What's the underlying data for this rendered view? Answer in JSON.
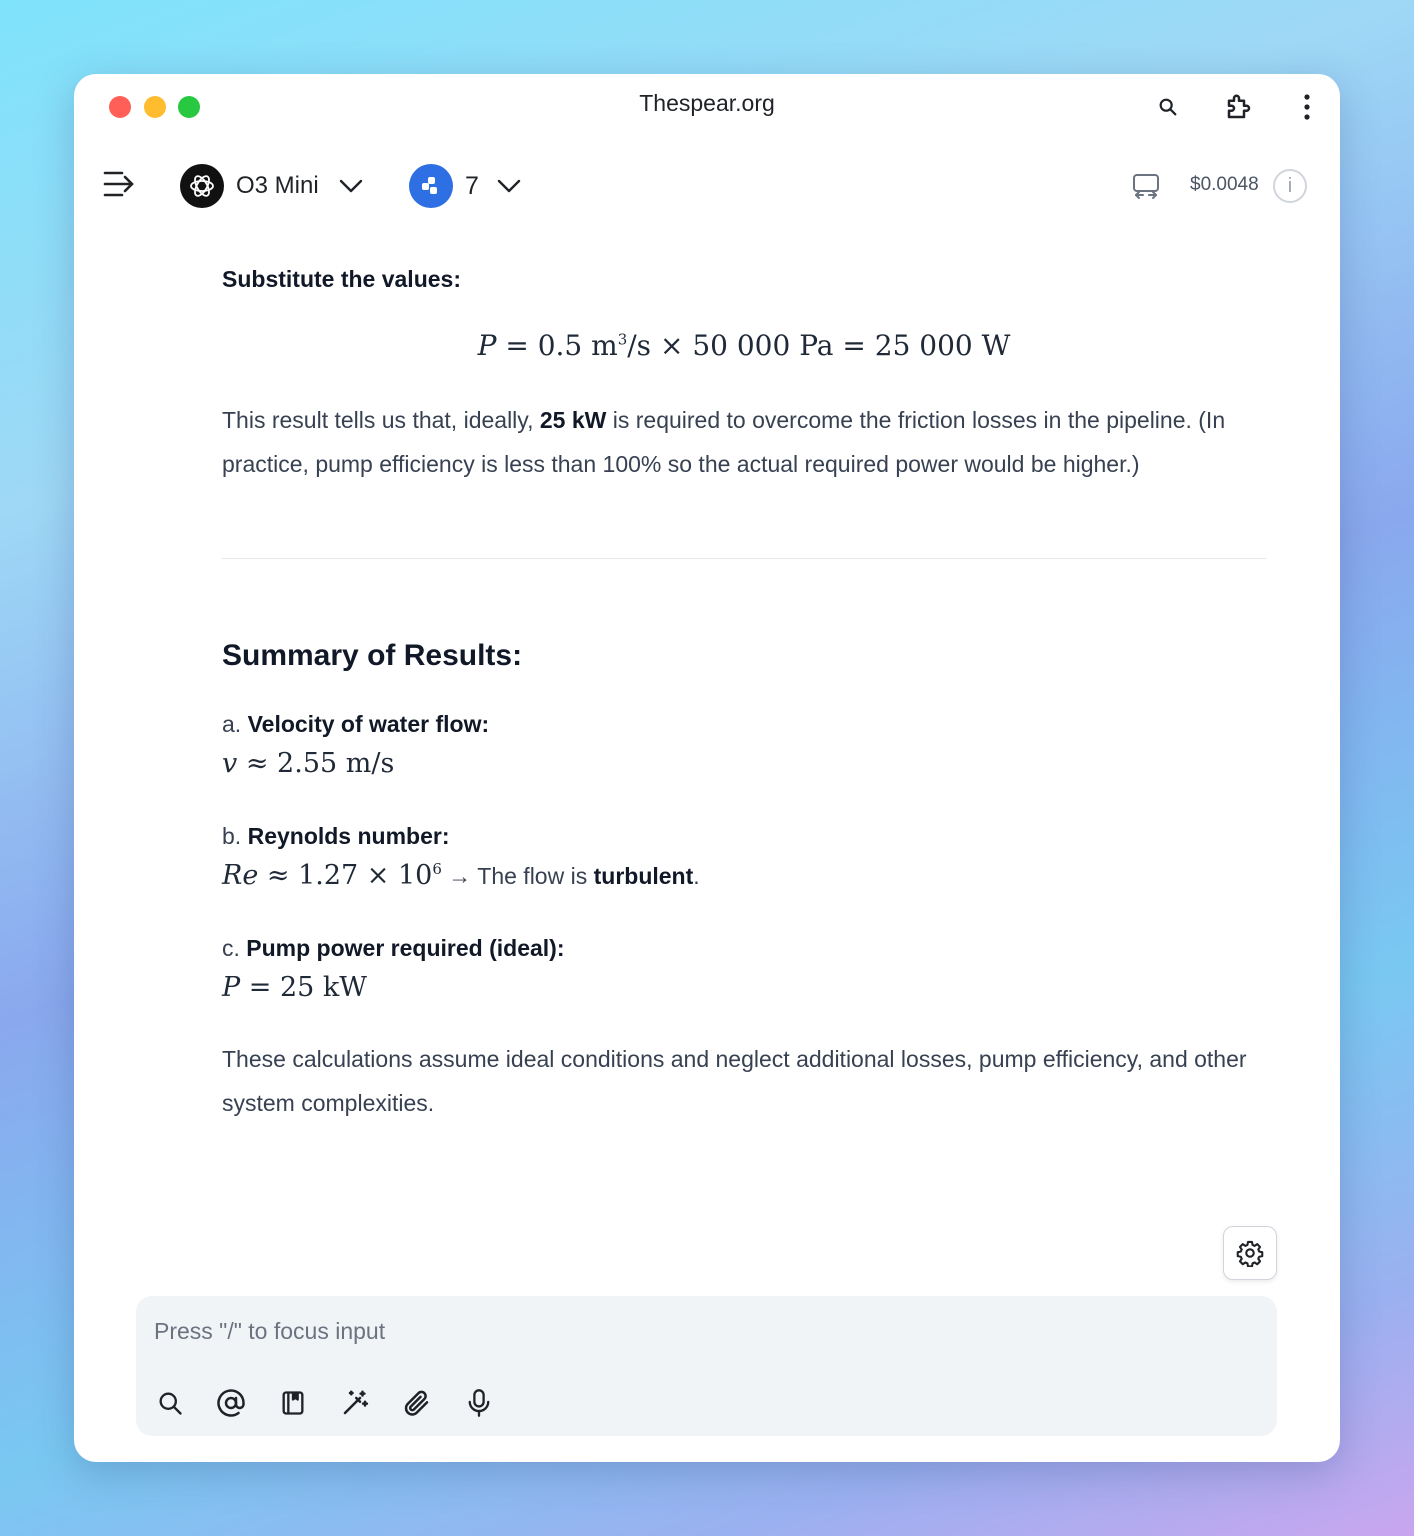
{
  "window": {
    "title": "Thespear.org"
  },
  "toolbar": {
    "model_name": "O3 Mini",
    "plugin_count": "7",
    "cost": "$0.0048",
    "info_glyph": "i"
  },
  "content": {
    "substitute_heading": "Substitute the values:",
    "equation": {
      "lhs": "P",
      "eq1": "=",
      "flow": "0.5 m",
      "flow_exp": "3",
      "flow_unit": "/s",
      "times": "×",
      "pressure": "50 000 Pa",
      "eq2": "=",
      "result": "25 000 W"
    },
    "result_para": {
      "part1": "This result tells us that, ideally, ",
      "bold": "25 kW",
      "part2": " is required to overcome the friction losses in the pipeline. (In practice, pump efficiency is less than 100% so the actual required power would be higher.)"
    },
    "summary_heading": "Summary of Results:",
    "items": [
      {
        "prefix": "a. ",
        "label": "Velocity of water flow:",
        "math_var": "v",
        "math_rest": " ≈ 2.55 m/s"
      },
      {
        "prefix": "b. ",
        "label": "Reynolds number:",
        "math_var": "Re",
        "math_rest": " ≈ 1.27 × 10",
        "math_exp": "6",
        "text_part": " → The flow is ",
        "text_bold": "turbulent",
        "text_end": "."
      },
      {
        "prefix": "c. ",
        "label": "Pump power required (ideal):",
        "math_var": "P",
        "math_rest": " = 25 kW"
      }
    ],
    "closing_para": "These calculations assume ideal conditions and neglect additional losses, pump efficiency, and other system complexities."
  },
  "input": {
    "placeholder": "Press \"/\" to focus input"
  },
  "icons": {
    "titlebar": [
      "search-icon",
      "extension-icon",
      "more-vertical-icon"
    ],
    "toolbar": [
      "sidebar-toggle-icon",
      "openai-logo-icon",
      "chevron-down-icon",
      "plugins-icon",
      "chevron-down-icon",
      "switch-window-icon",
      "info-icon"
    ],
    "input_actions": [
      "search-icon",
      "mention-icon",
      "prompt-library-icon",
      "magic-wand-icon",
      "attachment-icon",
      "microphone-icon"
    ],
    "floating": [
      "settings-gear-icon"
    ]
  },
  "colors": {
    "close": "#ff5f57",
    "minimize": "#febc2e",
    "maximize": "#28c840",
    "accent_blue": "#2f6fe4"
  }
}
